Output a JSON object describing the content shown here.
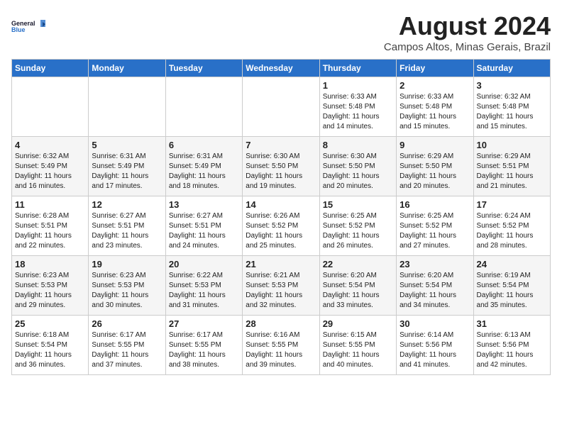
{
  "logo": {
    "line1": "General",
    "line2": "Blue"
  },
  "title": "August 2024",
  "location": "Campos Altos, Minas Gerais, Brazil",
  "days_of_week": [
    "Sunday",
    "Monday",
    "Tuesday",
    "Wednesday",
    "Thursday",
    "Friday",
    "Saturday"
  ],
  "weeks": [
    [
      {
        "day": "",
        "info": ""
      },
      {
        "day": "",
        "info": ""
      },
      {
        "day": "",
        "info": ""
      },
      {
        "day": "",
        "info": ""
      },
      {
        "day": "1",
        "info": "Sunrise: 6:33 AM\nSunset: 5:48 PM\nDaylight: 11 hours\nand 14 minutes."
      },
      {
        "day": "2",
        "info": "Sunrise: 6:33 AM\nSunset: 5:48 PM\nDaylight: 11 hours\nand 15 minutes."
      },
      {
        "day": "3",
        "info": "Sunrise: 6:32 AM\nSunset: 5:48 PM\nDaylight: 11 hours\nand 15 minutes."
      }
    ],
    [
      {
        "day": "4",
        "info": "Sunrise: 6:32 AM\nSunset: 5:49 PM\nDaylight: 11 hours\nand 16 minutes."
      },
      {
        "day": "5",
        "info": "Sunrise: 6:31 AM\nSunset: 5:49 PM\nDaylight: 11 hours\nand 17 minutes."
      },
      {
        "day": "6",
        "info": "Sunrise: 6:31 AM\nSunset: 5:49 PM\nDaylight: 11 hours\nand 18 minutes."
      },
      {
        "day": "7",
        "info": "Sunrise: 6:30 AM\nSunset: 5:50 PM\nDaylight: 11 hours\nand 19 minutes."
      },
      {
        "day": "8",
        "info": "Sunrise: 6:30 AM\nSunset: 5:50 PM\nDaylight: 11 hours\nand 20 minutes."
      },
      {
        "day": "9",
        "info": "Sunrise: 6:29 AM\nSunset: 5:50 PM\nDaylight: 11 hours\nand 20 minutes."
      },
      {
        "day": "10",
        "info": "Sunrise: 6:29 AM\nSunset: 5:51 PM\nDaylight: 11 hours\nand 21 minutes."
      }
    ],
    [
      {
        "day": "11",
        "info": "Sunrise: 6:28 AM\nSunset: 5:51 PM\nDaylight: 11 hours\nand 22 minutes."
      },
      {
        "day": "12",
        "info": "Sunrise: 6:27 AM\nSunset: 5:51 PM\nDaylight: 11 hours\nand 23 minutes."
      },
      {
        "day": "13",
        "info": "Sunrise: 6:27 AM\nSunset: 5:51 PM\nDaylight: 11 hours\nand 24 minutes."
      },
      {
        "day": "14",
        "info": "Sunrise: 6:26 AM\nSunset: 5:52 PM\nDaylight: 11 hours\nand 25 minutes."
      },
      {
        "day": "15",
        "info": "Sunrise: 6:25 AM\nSunset: 5:52 PM\nDaylight: 11 hours\nand 26 minutes."
      },
      {
        "day": "16",
        "info": "Sunrise: 6:25 AM\nSunset: 5:52 PM\nDaylight: 11 hours\nand 27 minutes."
      },
      {
        "day": "17",
        "info": "Sunrise: 6:24 AM\nSunset: 5:52 PM\nDaylight: 11 hours\nand 28 minutes."
      }
    ],
    [
      {
        "day": "18",
        "info": "Sunrise: 6:23 AM\nSunset: 5:53 PM\nDaylight: 11 hours\nand 29 minutes."
      },
      {
        "day": "19",
        "info": "Sunrise: 6:23 AM\nSunset: 5:53 PM\nDaylight: 11 hours\nand 30 minutes."
      },
      {
        "day": "20",
        "info": "Sunrise: 6:22 AM\nSunset: 5:53 PM\nDaylight: 11 hours\nand 31 minutes."
      },
      {
        "day": "21",
        "info": "Sunrise: 6:21 AM\nSunset: 5:53 PM\nDaylight: 11 hours\nand 32 minutes."
      },
      {
        "day": "22",
        "info": "Sunrise: 6:20 AM\nSunset: 5:54 PM\nDaylight: 11 hours\nand 33 minutes."
      },
      {
        "day": "23",
        "info": "Sunrise: 6:20 AM\nSunset: 5:54 PM\nDaylight: 11 hours\nand 34 minutes."
      },
      {
        "day": "24",
        "info": "Sunrise: 6:19 AM\nSunset: 5:54 PM\nDaylight: 11 hours\nand 35 minutes."
      }
    ],
    [
      {
        "day": "25",
        "info": "Sunrise: 6:18 AM\nSunset: 5:54 PM\nDaylight: 11 hours\nand 36 minutes."
      },
      {
        "day": "26",
        "info": "Sunrise: 6:17 AM\nSunset: 5:55 PM\nDaylight: 11 hours\nand 37 minutes."
      },
      {
        "day": "27",
        "info": "Sunrise: 6:17 AM\nSunset: 5:55 PM\nDaylight: 11 hours\nand 38 minutes."
      },
      {
        "day": "28",
        "info": "Sunrise: 6:16 AM\nSunset: 5:55 PM\nDaylight: 11 hours\nand 39 minutes."
      },
      {
        "day": "29",
        "info": "Sunrise: 6:15 AM\nSunset: 5:55 PM\nDaylight: 11 hours\nand 40 minutes."
      },
      {
        "day": "30",
        "info": "Sunrise: 6:14 AM\nSunset: 5:56 PM\nDaylight: 11 hours\nand 41 minutes."
      },
      {
        "day": "31",
        "info": "Sunrise: 6:13 AM\nSunset: 5:56 PM\nDaylight: 11 hours\nand 42 minutes."
      }
    ]
  ]
}
